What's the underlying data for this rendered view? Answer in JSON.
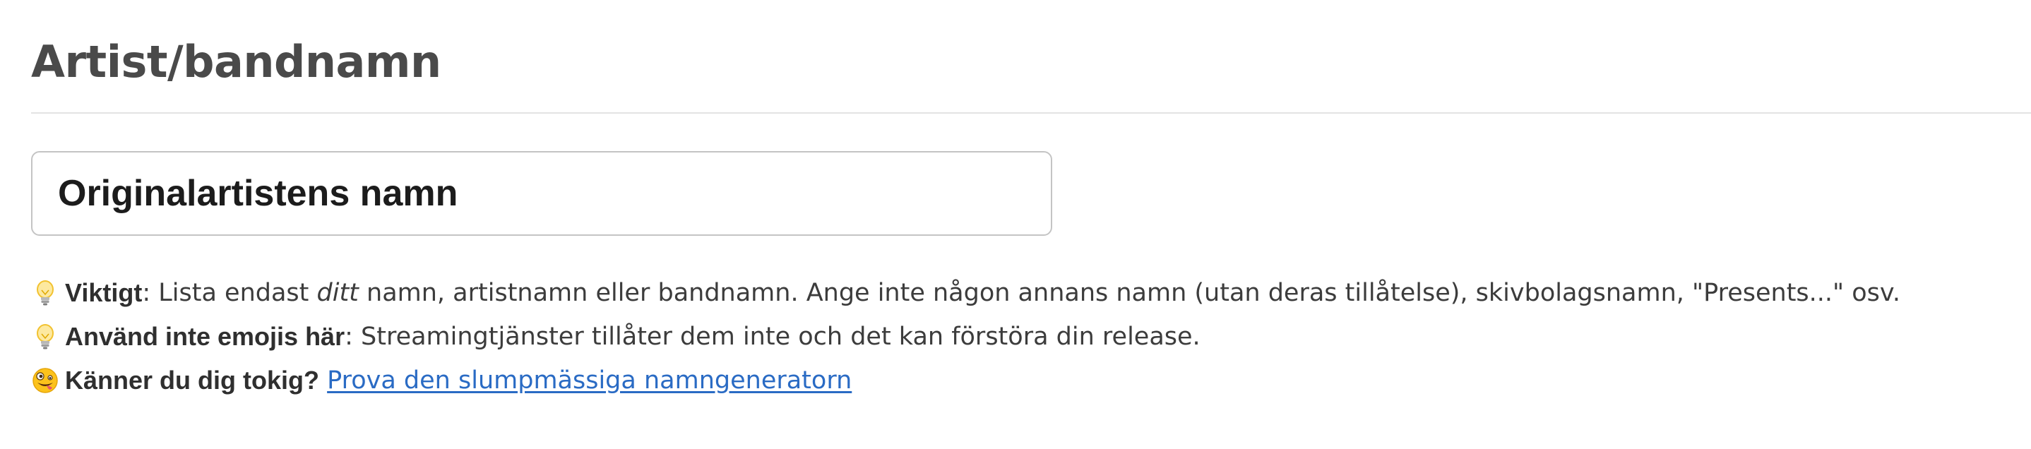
{
  "section": {
    "title": "Artist/bandnamn"
  },
  "name_field": {
    "value": "",
    "placeholder": "Originalartistens namn"
  },
  "tips": {
    "important": {
      "icon": "lightbulb-icon",
      "label": "Viktigt",
      "text_before": ": Lista endast ",
      "emphasis": "ditt",
      "text_after": " namn, artistnamn eller bandnamn. Ange inte någon annans namn (utan deras tillåtelse), skivbolagsnamn, \"Presents...\" osv."
    },
    "no_emojis": {
      "icon": "lightbulb-icon",
      "label": "Använd inte emojis här",
      "text": ": Streamingtjänster tillåter dem inte och det kan förstöra din release."
    },
    "crazy": {
      "icon": "zany-face-icon",
      "label": "Känner du dig tokig?",
      "link_text": "Prova den slumpmässiga namngeneratorn"
    }
  },
  "colors": {
    "link": "#2a6bc4",
    "heading": "#4a4a4a",
    "input_border": "#c4c4c4",
    "divider": "#e3e3e3"
  }
}
